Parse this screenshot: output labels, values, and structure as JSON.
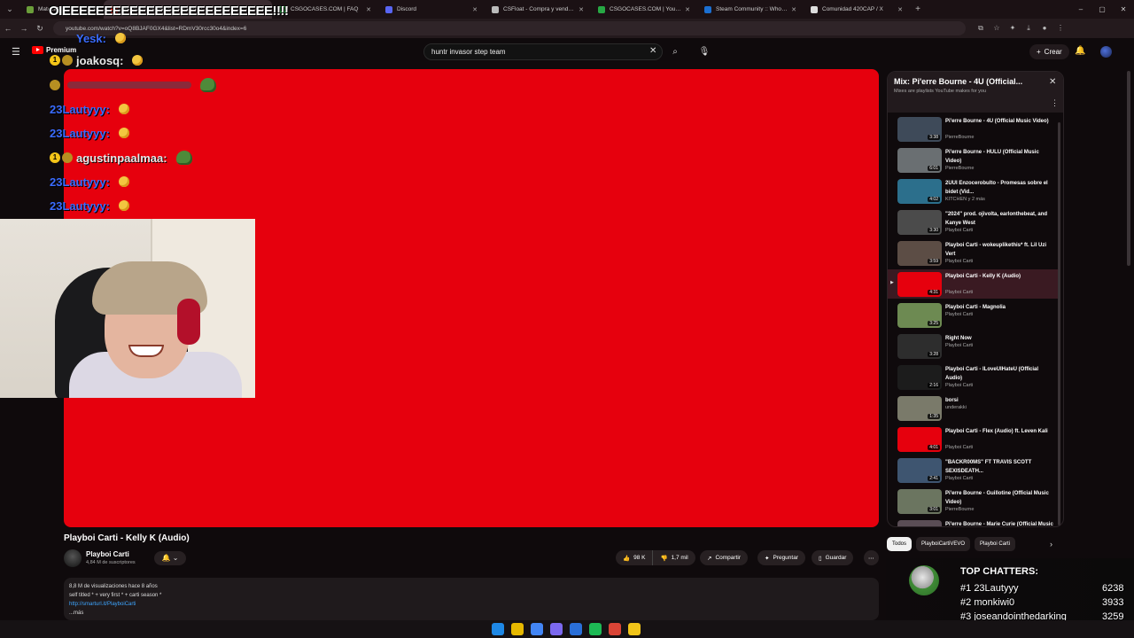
{
  "browser": {
    "tabs": [
      {
        "title": "Matecat",
        "fav": "#6b9e3a",
        "active": false
      },
      {
        "title": "Escucha a mate | Disfruta de la",
        "fav": "#e62117",
        "active": true
      },
      {
        "title": "CSGOCASES.COM | FAQ",
        "fav": "#27a844",
        "active": false
      },
      {
        "title": "Discord",
        "fav": "#5865f2",
        "active": false
      },
      {
        "title": "CSFloat - Compra y vende skin",
        "fav": "#bbbbbb",
        "active": false
      },
      {
        "title": "CSGOCASES.COM | Your panel",
        "fav": "#27a844",
        "active": false
      },
      {
        "title": "Steam Community :: Who can u",
        "fav": "#1b6fd1",
        "active": false
      },
      {
        "title": "Comunidad 420CAP / X",
        "fav": "#dddddd",
        "active": false
      }
    ],
    "url": "youtube.com/watch?v=oQ8BJAF0GX4&list=RDmV30rcc30o4&index=6"
  },
  "overlay": {
    "headline": "OIEEEEEEEEEEEEEEEEEEEEEEEEE!!!!",
    "chat": [
      {
        "name": "Yesk:",
        "color": "#3a6cff"
      },
      {
        "name": "joakosq:",
        "color": "#e8e8e8"
      },
      {
        "name": "",
        "color": "#e8e8e8"
      },
      {
        "name": "23Lautyyy:",
        "color": "#3a6cff"
      },
      {
        "name": "23Lautyyy:",
        "color": "#3a6cff"
      },
      {
        "name": "agustinpaalmaa:",
        "color": "#e8e8e8"
      },
      {
        "name": "23Lautyyy:",
        "color": "#3a6cff"
      },
      {
        "name": "23Lautyyy:",
        "color": "#3a6cff"
      }
    ]
  },
  "youtube": {
    "logo_label": "Premium",
    "search_value": "huntr invasor step team",
    "create_label": "Crear"
  },
  "video": {
    "title": "Playboi Carti - Kelly K (Audio)",
    "channel": "Playboi Carti",
    "subscribers": "4,84 M de suscriptores",
    "likes": "98 K",
    "dislikes": "1,7 mil",
    "share": "Compartir",
    "ask": "Preguntar",
    "save": "Guardar",
    "desc_line1": "8,8 M de visualizaciones  hace 8 años",
    "desc_line2": "self titled * + very first * + carti season *",
    "desc_link": "http://smarturl.it/PlayboiCarti",
    "desc_more": "...más"
  },
  "mix": {
    "title": "Mix: Pi'erre Bourne - 4U (Official...",
    "subtitle": "Mixes are playlists YouTube makes for you",
    "items": [
      {
        "title": "Pi'erre Bourne - 4U (Official Music Video)",
        "channel": "PierreBourne",
        "dur": "3:38",
        "thumb": "#3e4a59"
      },
      {
        "title": "Pi'erre Bourne - HULU (Official Music Video)",
        "channel": "PierreBourne",
        "dur": "6:01",
        "thumb": "#6a6f72"
      },
      {
        "title": "2UUI Enzocerobulto - Promesas sobre el bidet (Vid...",
        "channel": "KITCHEN y 2 más",
        "dur": "4:02",
        "thumb": "#2c6f8c"
      },
      {
        "title": "\"2024\" prod. ojivolta, earlonthebeat, and Kanye West",
        "channel": "Playboi Carti",
        "dur": "3:30",
        "thumb": "#4b4b4b"
      },
      {
        "title": "Playboi Carti - wokeuplikethis* ft. Lil Uzi Vert",
        "channel": "Playboi Carti",
        "dur": "3:59",
        "thumb": "#5c4d45"
      },
      {
        "title": "Playboi Carti - Kelly K (Audio)",
        "channel": "Playboi Carti",
        "dur": "4:31",
        "thumb": "#e6000d"
      },
      {
        "title": "Playboi Carti - Magnolia",
        "channel": "Playboi Carti",
        "dur": "3:25",
        "thumb": "#6d8a52"
      },
      {
        "title": "Right Now",
        "channel": "Playboi Carti",
        "dur": "3:28",
        "thumb": "#2d2d2d"
      },
      {
        "title": "Playboi Carti - ILoveUIHateU (Official Audio)",
        "channel": "Playboi Carti",
        "dur": "2:16",
        "thumb": "#1c1c1c"
      },
      {
        "title": "borsi",
        "channel": "underakki",
        "dur": "1:35",
        "thumb": "#7a7a6a"
      },
      {
        "title": "Playboi Carti - Flex (Audio) ft. Leven Kali",
        "channel": "Playboi Carti",
        "dur": "4:01",
        "thumb": "#e6000d"
      },
      {
        "title": "\"BACKR00MS\" FT TRAVIS SCOTT SEXISDEATH...",
        "channel": "Playboi Carti",
        "dur": "2:41",
        "thumb": "#3e5570"
      },
      {
        "title": "Pi'erre Bourne - Guillotine (Official Music Video)",
        "channel": "PierreBourne",
        "dur": "3:01",
        "thumb": "#6b7560"
      },
      {
        "title": "Pi'erre Bourne - Marie Curie (Official Music Video)",
        "channel": "",
        "dur": "",
        "thumb": "#5a4d55"
      }
    ]
  },
  "chips": [
    "Todos",
    "PlayboiCartiVEVO",
    "Playboi Carti"
  ],
  "top_chatters": {
    "heading": "TOP CHATTERS:",
    "rows": [
      {
        "rank": "#1",
        "name": "23Lautyyy",
        "score": "6238"
      },
      {
        "rank": "#2",
        "name": "monkiwi0",
        "score": "3933"
      },
      {
        "rank": "#3",
        "name": "joseandointhedarking",
        "score": "3259"
      }
    ]
  },
  "taskbar": {
    "icons": [
      "#1e88e5",
      "#e6b800",
      "#4285f4",
      "#7b68ee",
      "#2a6fd8",
      "#1db954",
      "#d94436",
      "#f0c419"
    ]
  }
}
